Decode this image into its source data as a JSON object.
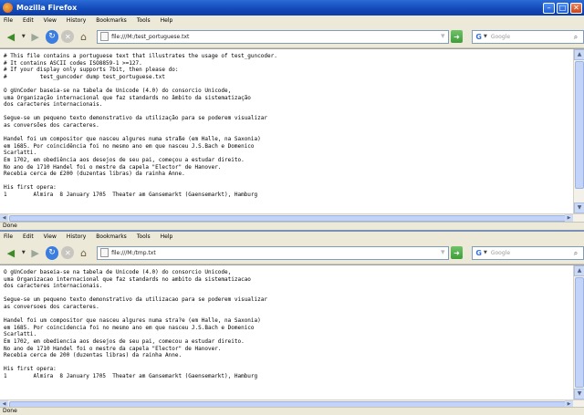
{
  "window": {
    "title": "Mozilla Firefox"
  },
  "menu": [
    "File",
    "Edit",
    "View",
    "History",
    "Bookmarks",
    "Tools",
    "Help"
  ],
  "top": {
    "url": "file:///M:/test_portuguese.txt",
    "search_placeholder": "Google",
    "status": "Done",
    "text": "# This file contains a portuguese text that illustrates the usage of test_guncoder.\n# It contains ASCII codes ISO8859-1 >=127.\n# If your display only supports 7bit, then please do:\n#          test_guncoder dump test_portuguese.txt\n\nO gUnCoder baseia-se na tabela de Unicode (4.0) do consorcio Unicode,\numa Organização internacional que faz standards no âmbito da sistematização\ndos caracteres internacionais.\n\nSegue-se um pequeno texto demonstrativo da utilização para se poderem visualizar\nas conversões dos caracteres.\n\nHandel foi um compositor que nasceu algures numa straße (em Halle, na Saxonia)\nem 1685. Por coincidência foi no mesmo ano em que nasceu J.S.Bach e Domenico\nScarlatti.\nEm 1702, em obediência aos desejos de seu pai, começou a estudar direito.\nNo ano de 1710 Handel foi o mestre da capela \"Elector\" de Hanover.\nRecebia cerca de £200 (duzentas libras) da rainha Anne.\n\nHis first opera:\n1        Almira  8 January 1705  Theater am Gansemarkt (Gaensemarkt), Hamburg"
  },
  "bottom": {
    "url": "file:///M:/tmp.txt",
    "search_placeholder": "Google",
    "status": "Done",
    "text": "O gUnCoder baseia-se na tabela de Unicode (4.0) do consorcio Unicode,\numa Organizacao internacional que faz standards no ambito da sistematizacao\ndos caracteres internacionais.\n\nSegue-se um pequeno texto demonstrativo da utilizacao para se poderem visualizar\nas conversoes dos caracteres.\n\nHandel foi um compositor que nasceu algures numa stra?e (em Halle, na Saxonia)\nem 1685. Por coincidencia foi no mesmo ano em que nasceu J.S.Bach e Domenico\nScarlatti.\nEm 1702, em obediencia aos desejos de seu pai, comecou a estudar direito.\nNo ano de 1710 Handel foi o mestre da capela \"Elector\" de Hanover.\nRecebia cerca de 200 (duzentas libras) da rainha Anne.\n\nHis first opera:\n1        Almira  8 January 1705  Theater am Gansemarkt (Gaensemarkt), Hamburg"
  }
}
